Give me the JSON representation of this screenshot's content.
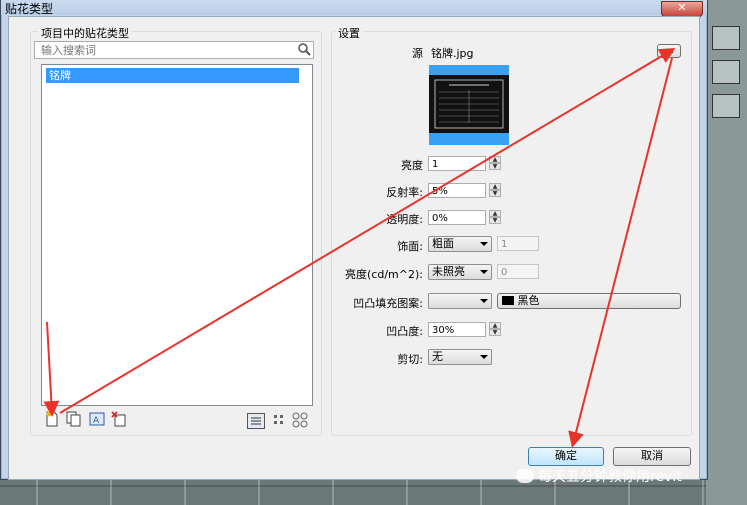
{
  "dialog": {
    "title": "贴花类型",
    "close_glyph": "✕"
  },
  "left_panel": {
    "group_label": "项目中的贴花类型",
    "search_placeholder": "输入搜索词",
    "items": [
      "铭牌"
    ]
  },
  "settings": {
    "group_label": "设置",
    "source_label": "源",
    "source_value": "铭牌.jpg",
    "browse_label": "...",
    "brightness_label": "亮度",
    "brightness_value": "1",
    "reflectivity_label": "反射率:",
    "reflectivity_value": "5%",
    "transparency_label": "透明度:",
    "transparency_value": "0%",
    "finish_label": "饰面:",
    "finish_value": "粗面",
    "finish_num": "1",
    "luminance_label": "亮度(cd/m^2):",
    "luminance_value": "未照亮",
    "luminance_num": "0",
    "bump_pattern_label": "凹凸填充图案:",
    "bump_pattern_value": "",
    "color_value": "黑色",
    "bump_amount_label": "凹凸度:",
    "bump_amount_value": "30%",
    "cutout_label": "剪切:",
    "cutout_value": "无"
  },
  "footer": {
    "ok_label": "确定",
    "cancel_label": "取消"
  },
  "watermark": "每天五分钟教你用revit",
  "colors": {
    "annotation": "#e8332b",
    "selection": "#3399ff"
  }
}
